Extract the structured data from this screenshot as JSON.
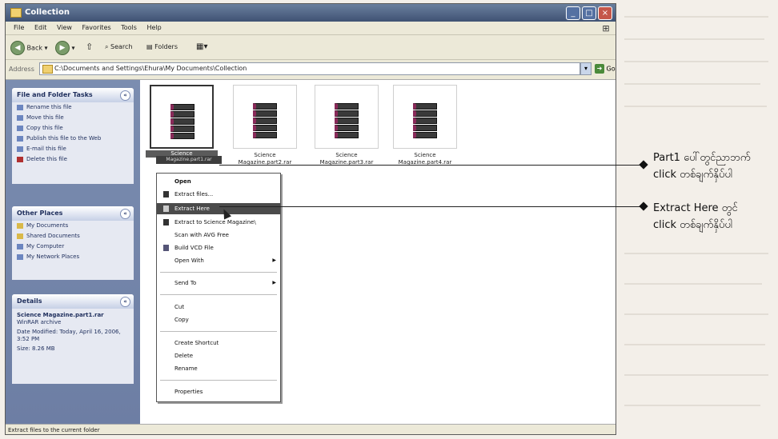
{
  "window": {
    "title": "Collection",
    "menu": [
      "File",
      "Edit",
      "View",
      "Favorites",
      "Tools",
      "Help"
    ],
    "toolbar": {
      "back_label": "Back",
      "search_label": "Search",
      "folders_label": "Folders"
    },
    "address": {
      "label": "Address",
      "value": "C:\\Documents and Settings\\Ehura\\My Documents\\Collection",
      "go_label": "Go"
    }
  },
  "left_pane": {
    "file_tasks": {
      "title": "File and Folder Tasks",
      "items": [
        "Rename this file",
        "Move this file",
        "Copy this file",
        "Publish this file to the Web",
        "E-mail this file",
        "Delete this file"
      ]
    },
    "other_places": {
      "title": "Other Places",
      "items": [
        "My Documents",
        "Shared Documents",
        "My Computer",
        "My Network Places"
      ]
    },
    "details": {
      "title": "Details",
      "name": "Science Magazine.part1.rar",
      "type": "WinRAR archive",
      "modified": "Date Modified: Today, April 16, 2006, 3:52 PM",
      "size": "Size: 8.26 MB"
    }
  },
  "files": [
    {
      "name_line1": "Science",
      "name_line2": "Magazine.part1.rar",
      "selected": true
    },
    {
      "name_line1": "Science",
      "name_line2": "Magazine.part2.rar",
      "selected": false
    },
    {
      "name_line1": "Science",
      "name_line2": "Magazine.part3.rar",
      "selected": false
    },
    {
      "name_line1": "Science",
      "name_line2": "Magazine.part4.rar",
      "selected": false
    }
  ],
  "selected_label": "Science",
  "context_menu": {
    "open": "Open",
    "extract_files": "Extract files...",
    "extract_here": "Extract Here",
    "extract_to": "Extract to Science Magazine\\",
    "scan": "Scan with AVG Free",
    "build_vcd": "Build VCD File",
    "open_with": "Open With",
    "send_to": "Send To",
    "cut": "Cut",
    "copy": "Copy",
    "create_shortcut": "Create Shortcut",
    "delete": "Delete",
    "rename": "Rename",
    "properties": "Properties"
  },
  "status_bar": "Extract files to the current folder",
  "annotations": {
    "part1_line1": "Part1 ပေါ်တွင်ညာဘက်",
    "part1_line2": "click တစ်ချက်နှိပ်ပါ",
    "extract_line1": "Extract Here တွင်",
    "extract_line2": "click တစ်ချက်နှိပ်ပါ"
  }
}
